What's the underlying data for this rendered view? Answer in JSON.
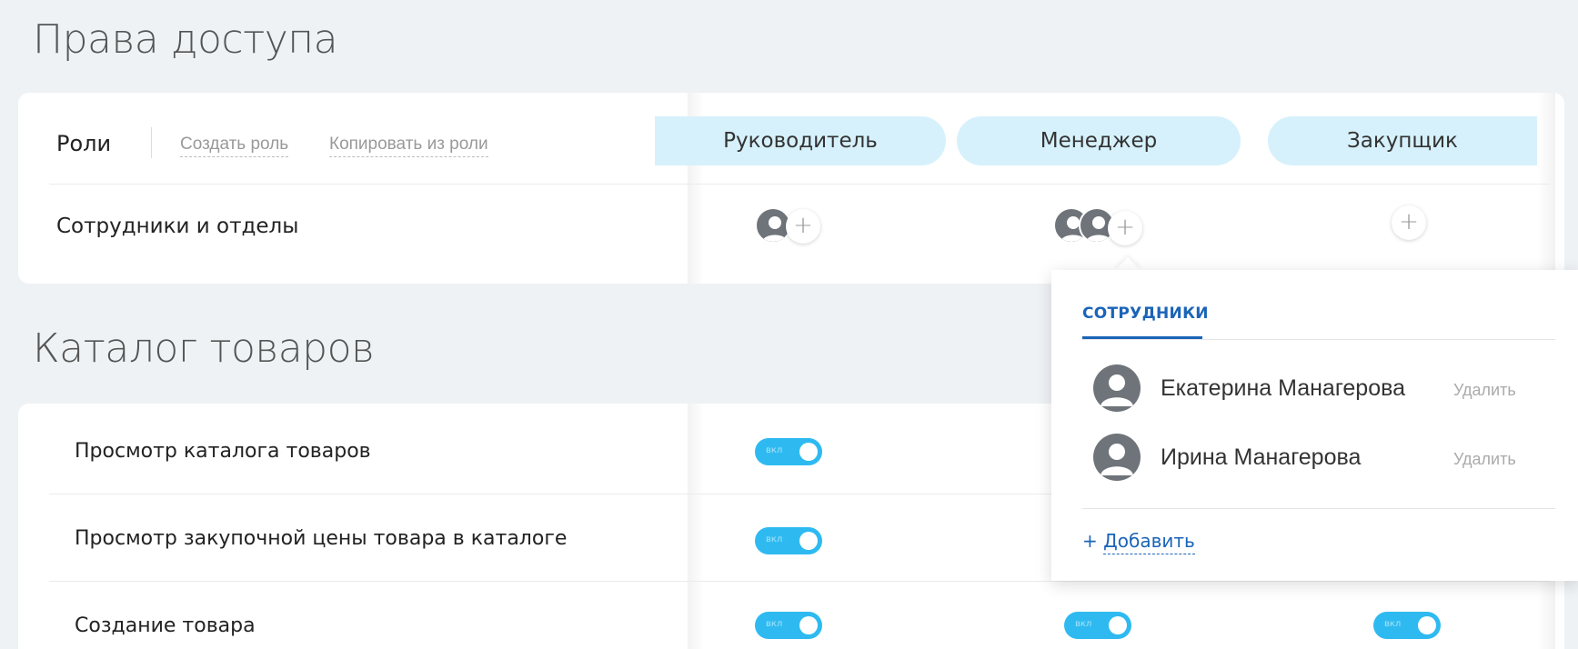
{
  "page": {
    "section1_title": "Права доступа",
    "section2_title": "Каталог товаров"
  },
  "roles": {
    "label": "Роли",
    "create_link": "Создать роль",
    "copy_link": "Копировать из роли",
    "items": [
      "Руководитель",
      "Менеджер",
      "Закупщик"
    ]
  },
  "employees_row": {
    "label": "Сотрудники и отделы",
    "add_symbol": "+"
  },
  "catalog": {
    "rows": [
      {
        "label": "Просмотр каталога товаров"
      },
      {
        "label": "Просмотр закупочной цены товара в каталоге"
      },
      {
        "label": "Создание товара"
      }
    ],
    "toggle_text": "вкл"
  },
  "popover": {
    "tab": "СОТРУДНИКИ",
    "employees": [
      {
        "name": "Екатерина Манагерова",
        "remove": "Удалить"
      },
      {
        "name": "Ирина Манагерова",
        "remove": "Удалить"
      }
    ],
    "add_plus": "+",
    "add_label": "Добавить"
  },
  "colors": {
    "role_pill": "#d6f1fb",
    "toggle_on": "#2ebaf0",
    "link_blue": "#1b64b8",
    "avatar_gray": "#6f747a",
    "background": "#eef2f5"
  }
}
